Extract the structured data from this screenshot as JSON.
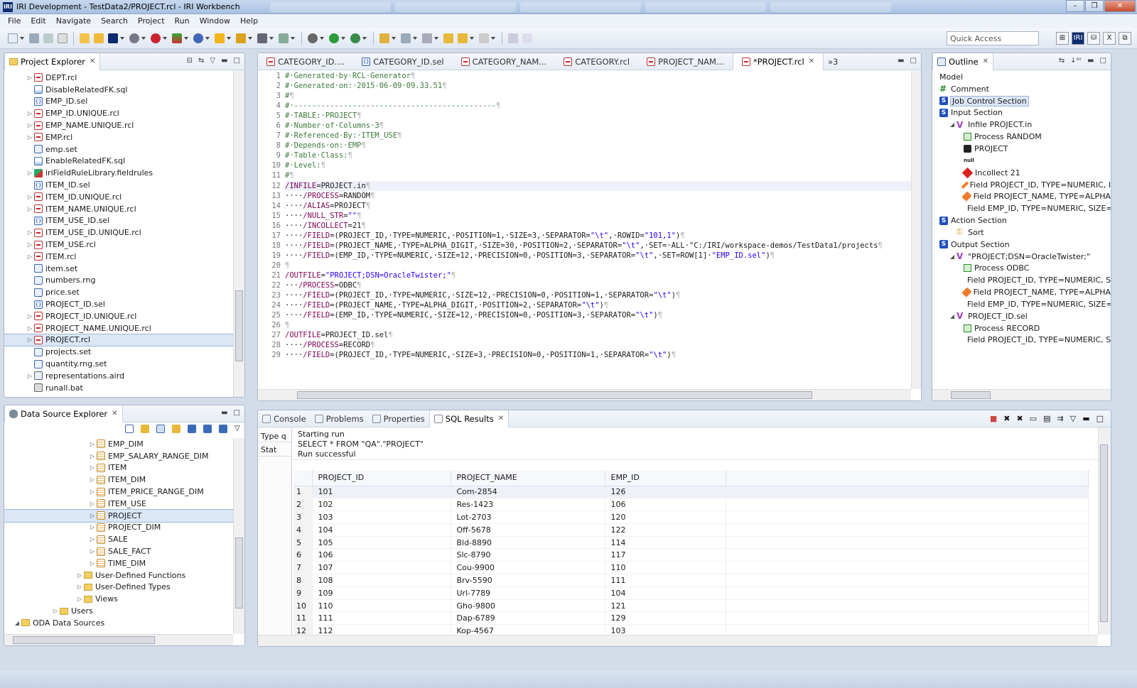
{
  "window": {
    "title": "IRI Development - TestData2/PROJECT.rcl - IRI Workbench",
    "app_icon": "IRI"
  },
  "menu": [
    "File",
    "Edit",
    "Navigate",
    "Search",
    "Project",
    "Run",
    "Window",
    "Help"
  ],
  "quick_access": {
    "placeholder": "Quick Access"
  },
  "project_explorer": {
    "title": "Project Explorer",
    "items": [
      {
        "label": "DEPT.rcl",
        "icon": "rcl-icon",
        "expand": true
      },
      {
        "label": "DisableRelatedFK.sql",
        "icon": "sql-icon",
        "expand": false
      },
      {
        "label": "EMP_ID.sel",
        "icon": "sel-icon",
        "expand": false
      },
      {
        "label": "EMP_ID.UNIQUE.rcl",
        "icon": "rcl-icon",
        "expand": true
      },
      {
        "label": "EMP_NAME.UNIQUE.rcl",
        "icon": "rcl-icon",
        "expand": true
      },
      {
        "label": "EMP.rcl",
        "icon": "rcl-icon",
        "expand": true
      },
      {
        "label": "emp.set",
        "icon": "set-icon",
        "expand": false
      },
      {
        "label": "EnableRelatedFK.sql",
        "icon": "sql-icon",
        "expand": false
      },
      {
        "label": "iriFieldRuleLibrary.fieldrules",
        "icon": "fieldrules-icon",
        "expand": true
      },
      {
        "label": "ITEM_ID.sel",
        "icon": "sel-icon",
        "expand": false
      },
      {
        "label": "ITEM_ID.UNIQUE.rcl",
        "icon": "rcl-icon",
        "expand": true
      },
      {
        "label": "ITEM_NAME.UNIQUE.rcl",
        "icon": "rcl-icon",
        "expand": true
      },
      {
        "label": "ITEM_USE_ID.sel",
        "icon": "sel-icon",
        "expand": false
      },
      {
        "label": "ITEM_USE_ID.UNIQUE.rcl",
        "icon": "rcl-icon",
        "expand": true
      },
      {
        "label": "ITEM_USE.rcl",
        "icon": "rcl-icon",
        "expand": true
      },
      {
        "label": "ITEM.rcl",
        "icon": "rcl-icon",
        "expand": true
      },
      {
        "label": "item.set",
        "icon": "set-icon",
        "expand": false
      },
      {
        "label": "numbers.rng",
        "icon": "rng-icon",
        "expand": false
      },
      {
        "label": "price.set",
        "icon": "set-icon",
        "expand": false
      },
      {
        "label": "PROJECT_ID.sel",
        "icon": "sel-icon",
        "expand": false
      },
      {
        "label": "PROJECT_ID.UNIQUE.rcl",
        "icon": "rcl-icon",
        "expand": true
      },
      {
        "label": "PROJECT_NAME.UNIQUE.rcl",
        "icon": "rcl-icon",
        "expand": true
      },
      {
        "label": "PROJECT.rcl",
        "icon": "rcl-icon",
        "expand": true,
        "selected": true
      },
      {
        "label": "projects.set",
        "icon": "set-icon",
        "expand": false
      },
      {
        "label": "quantity.rng.set",
        "icon": "set-icon",
        "expand": false
      },
      {
        "label": "representations.aird",
        "icon": "aird-icon",
        "expand": true
      },
      {
        "label": "runall.bat",
        "icon": "bat-icon",
        "expand": false
      }
    ]
  },
  "data_source_explorer": {
    "title": "Data Source Explorer",
    "items": [
      {
        "label": "EMP_DIM",
        "icon": "table-icon",
        "depth": 3
      },
      {
        "label": "EMP_SALARY_RANGE_DIM",
        "icon": "table-icon",
        "depth": 3
      },
      {
        "label": "ITEM",
        "icon": "table-icon",
        "depth": 3
      },
      {
        "label": "ITEM_DIM",
        "icon": "table-icon",
        "depth": 3
      },
      {
        "label": "ITEM_PRICE_RANGE_DIM",
        "icon": "table-icon",
        "depth": 3
      },
      {
        "label": "ITEM_USE",
        "icon": "table-icon",
        "depth": 3
      },
      {
        "label": "PROJECT",
        "icon": "table-icon",
        "depth": 3,
        "selected": true
      },
      {
        "label": "PROJECT_DIM",
        "icon": "table-icon",
        "depth": 3
      },
      {
        "label": "SALE",
        "icon": "table-icon",
        "depth": 3
      },
      {
        "label": "SALE_FACT",
        "icon": "table-icon",
        "depth": 3
      },
      {
        "label": "TIME_DIM",
        "icon": "table-icon",
        "depth": 3
      },
      {
        "label": "User-Defined Functions",
        "icon": "folder-icon",
        "depth": 2
      },
      {
        "label": "User-Defined Types",
        "icon": "folder-icon",
        "depth": 2
      },
      {
        "label": "Views",
        "icon": "folder-icon",
        "depth": 2
      },
      {
        "label": "Users",
        "icon": "folder-icon",
        "depth": 1
      },
      {
        "label": "ODA Data Sources",
        "icon": "folder-icon",
        "depth": 0,
        "open": true
      }
    ]
  },
  "editor": {
    "tabs": [
      {
        "label": "CATEGORY_ID....",
        "icon": "rcl-icon"
      },
      {
        "label": "CATEGORY_ID.sel",
        "icon": "sel-icon"
      },
      {
        "label": "CATEGORY_NAM...",
        "icon": "rcl-icon"
      },
      {
        "label": "CATEGORY.rcl",
        "icon": "rcl-icon"
      },
      {
        "label": "PROJECT_NAM...",
        "icon": "rcl-icon"
      },
      {
        "label": "*PROJECT.rcl",
        "icon": "rcl-icon",
        "active": true
      }
    ],
    "overflow": "»3",
    "lines": [
      "# Generated by RCL Generator",
      "# Generated on: 2015-06-09 09.33.51",
      "#",
      "# ---------------------------------------------",
      "# TABLE: PROJECT",
      "# Number of Columns 3",
      "# Referenced By: ITEM_USE",
      "# Depends on: EMP",
      "# Table Class:",
      "# Level:",
      "#",
      "/INFILE=PROJECT.in",
      "    /PROCESS=RANDOM",
      "    /ALIAS=PROJECT",
      "    /NULL_STR=\"\"",
      "    /INCOLLECT=21",
      "    /FIELD=(PROJECT_ID, TYPE=NUMERIC, POSITION=1, SIZE=3, SEPARATOR=\"\\t\", ROWID=\"101,1\")",
      "    /FIELD=(PROJECT_NAME, TYPE=ALPHA_DIGIT, SIZE=30, POSITION=2, SEPARATOR=\"\\t\", SET= ALL \"C:/IRI/workspace-demos/TestData1/projects",
      "    /FIELD=(EMP_ID, TYPE=NUMERIC, SIZE=12, PRECISION=0, POSITION=3, SEPARATOR=\"\\t\", SET=ROW[1] \"EMP_ID.sel\")",
      "",
      "/OUTFILE=\"PROJECT;DSN=OracleTwister;\"",
      "   /PROCESS=ODBC",
      "    /FIELD=(PROJECT_ID, TYPE=NUMERIC, SIZE=12, PRECISION=0, POSITION=1, SEPARATOR=\"\\t\")",
      "    /FIELD=(PROJECT_NAME, TYPE=ALPHA_DIGIT, POSITION=2, SEPARATOR=\"\\t\")",
      "    /FIELD=(EMP_ID, TYPE=NUMERIC, SIZE=12, PRECISION=0, POSITION=3, SEPARATOR=\"\\t\")",
      "",
      "/OUTFILE=PROJECT_ID.sel",
      "    /PROCESS=RECORD",
      "    /FIELD=(PROJECT_ID, TYPE=NUMERIC, SIZE=3, PRECISION=0, POSITION=1, SEPARATOR=\"\\t\")"
    ]
  },
  "outline": {
    "title": "Outline",
    "items": [
      {
        "label": "Model",
        "icon": "none",
        "depth": 0
      },
      {
        "label": "Comment",
        "icon": "comment-icon",
        "depth": 0
      },
      {
        "label": "Job Control Section",
        "icon": "section-icon",
        "depth": 0,
        "selected": true
      },
      {
        "label": "Input Section",
        "icon": "section-icon",
        "depth": 0
      },
      {
        "label": "Infile PROJECT.in",
        "icon": "file-v-icon",
        "depth": 1,
        "open": true
      },
      {
        "label": "Process RANDOM",
        "icon": "process-icon",
        "depth": 2
      },
      {
        "label": "PROJECT",
        "icon": "alias-icon",
        "depth": 2
      },
      {
        "label": "null",
        "icon": "none",
        "depth": 2,
        "small": true
      },
      {
        "label": "Incollect 21",
        "icon": "incollect-icon",
        "depth": 2
      },
      {
        "label": "Field PROJECT_ID, TYPE=NUMERIC, I",
        "icon": "field-icon",
        "depth": 2
      },
      {
        "label": "Field PROJECT_NAME, TYPE=ALPHA",
        "icon": "field-icon",
        "depth": 2
      },
      {
        "label": "Field EMP_ID, TYPE=NUMERIC, SIZE=",
        "icon": "field-icon",
        "depth": 2
      },
      {
        "label": "Action Section",
        "icon": "section-icon",
        "depth": 0
      },
      {
        "label": "Sort",
        "icon": "sort-icon",
        "depth": 1
      },
      {
        "label": "Output Section",
        "icon": "section-icon",
        "depth": 0
      },
      {
        "label": "\"PROJECT;DSN=OracleTwister;\"",
        "icon": "file-v-icon",
        "depth": 1,
        "open": true
      },
      {
        "label": "Process ODBC",
        "icon": "process-icon",
        "depth": 2
      },
      {
        "label": "Field PROJECT_ID, TYPE=NUMERIC, S",
        "icon": "field-icon",
        "depth": 2
      },
      {
        "label": "Field PROJECT_NAME, TYPE=ALPHA",
        "icon": "field-icon",
        "depth": 2
      },
      {
        "label": "Field EMP_ID, TYPE=NUMERIC, SIZE=",
        "icon": "field-icon",
        "depth": 2
      },
      {
        "label": "PROJECT_ID.sel",
        "icon": "file-v-icon",
        "depth": 1,
        "open": true
      },
      {
        "label": "Process RECORD",
        "icon": "process-icon",
        "depth": 2
      },
      {
        "label": "Field PROJECT_ID, TYPE=NUMERIC, S",
        "icon": "field-icon",
        "depth": 2
      }
    ]
  },
  "bottom": {
    "tabs": [
      {
        "label": "Console",
        "icon": "console-icon"
      },
      {
        "label": "Problems",
        "icon": "problems-icon"
      },
      {
        "label": "Properties",
        "icon": "properties-icon"
      },
      {
        "label": "SQL Results",
        "icon": "sql-results-icon",
        "active": true
      }
    ],
    "side_headers": [
      "Type q",
      "Stat"
    ],
    "status_lines": [
      "Starting run",
      "SELECT * FROM \"QA\".\"PROJECT\"",
      "Run successful"
    ],
    "columns": [
      "PROJECT_ID",
      "PROJECT_NAME",
      "EMP_ID"
    ],
    "rows": [
      [
        "1",
        "101",
        "Com-2854",
        "126"
      ],
      [
        "2",
        "102",
        "Res-1423",
        "106"
      ],
      [
        "3",
        "103",
        "Lot-2703",
        "120"
      ],
      [
        "4",
        "104",
        "Off-5678",
        "122"
      ],
      [
        "5",
        "105",
        "Bld-8890",
        "114"
      ],
      [
        "6",
        "106",
        "Slc-8790",
        "117"
      ],
      [
        "7",
        "107",
        "Cou-9900",
        "110"
      ],
      [
        "8",
        "108",
        "Brv-5590",
        "111"
      ],
      [
        "9",
        "109",
        "Url-7789",
        "104"
      ],
      [
        "10",
        "110",
        "Gho-9800",
        "121"
      ],
      [
        "11",
        "111",
        "Dap-6789",
        "129"
      ],
      [
        "12",
        "112",
        "Kop-4567",
        "103"
      ]
    ]
  }
}
